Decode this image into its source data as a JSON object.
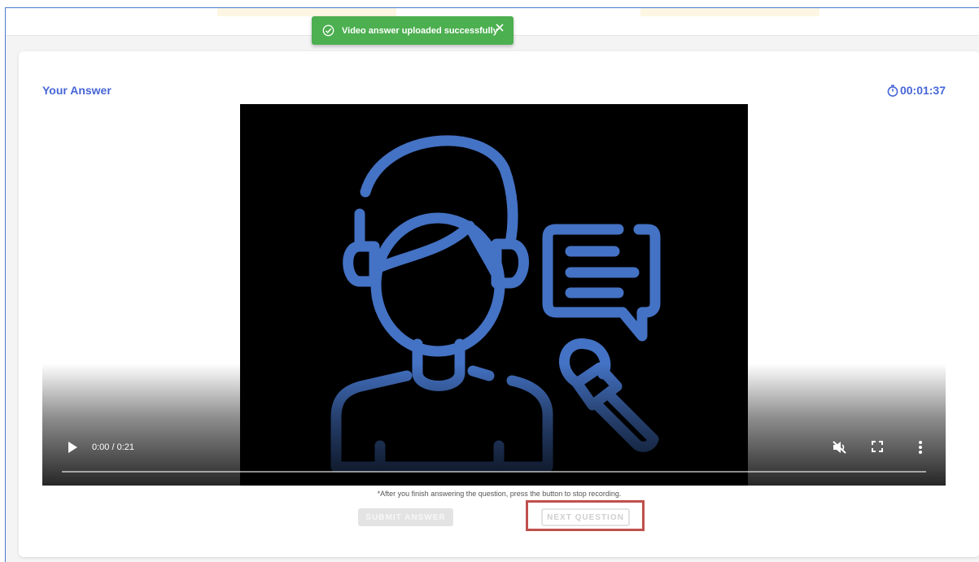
{
  "toast": {
    "message": "Video answer uploaded successfully",
    "icon": "check-circle-icon",
    "close_icon": "close-icon",
    "color": "#4caf50"
  },
  "answer": {
    "title": "Your Answer",
    "timer": "00:01:37",
    "timer_icon": "stopwatch-icon",
    "accent_color": "#4766d6"
  },
  "video": {
    "time_display": "0:00 / 0:21",
    "progress": 0,
    "icons": [
      "play-icon",
      "mute-icon",
      "fullscreen-icon",
      "more-options-icon"
    ]
  },
  "hint": "*After you finish answering the question, press the button to stop recording.",
  "buttons": {
    "submit": "SUBMIT ANSWER",
    "next": "NEXT QUESTION"
  },
  "highlight_color": "#c0504d"
}
